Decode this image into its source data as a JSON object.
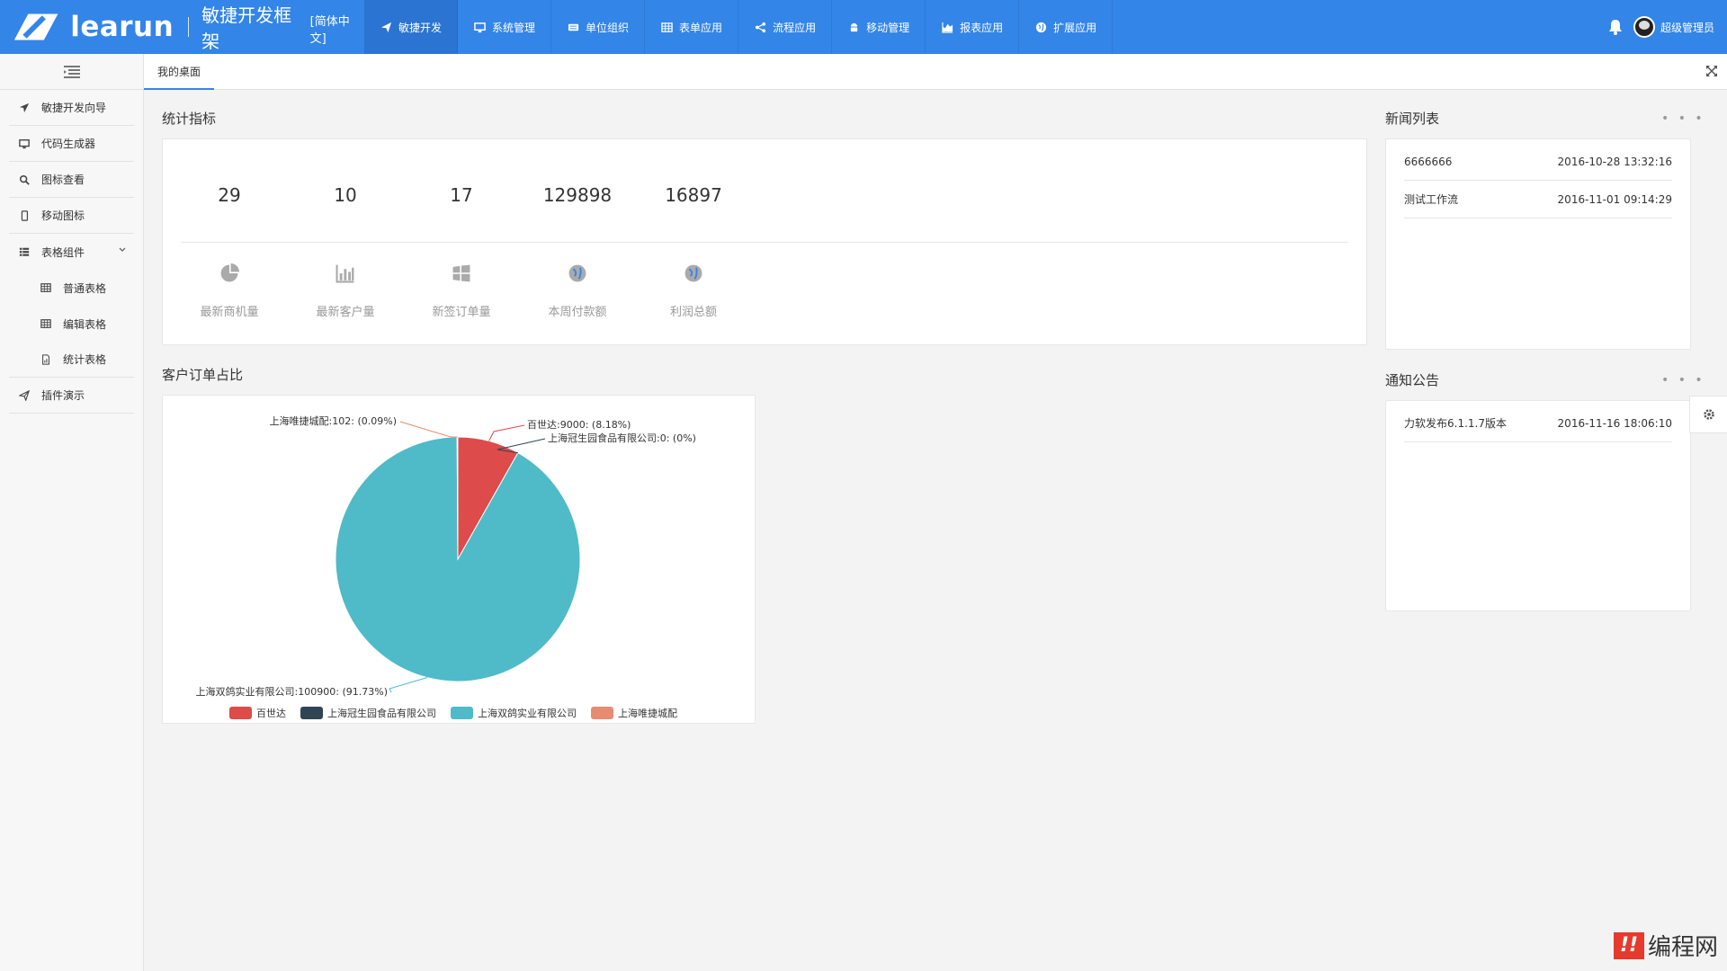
{
  "brand": {
    "name": "learun",
    "subtitle": "敏捷开发框架",
    "lang": "[简体中文]"
  },
  "nav": [
    {
      "label": "敏捷开发",
      "icon": "paper-plane-icon",
      "active": true
    },
    {
      "label": "系统管理",
      "icon": "monitor-icon"
    },
    {
      "label": "单位组织",
      "icon": "keyboard-icon"
    },
    {
      "label": "表单应用",
      "icon": "table-icon"
    },
    {
      "label": "流程应用",
      "icon": "share-icon"
    },
    {
      "label": "移动管理",
      "icon": "android-icon"
    },
    {
      "label": "报表应用",
      "icon": "area-chart-icon"
    },
    {
      "label": "扩展应用",
      "icon": "globe-icon"
    }
  ],
  "user": {
    "name": "超级管理员"
  },
  "sidebar": {
    "items": [
      {
        "label": "敏捷开发向导",
        "icon": "location-arrow-icon"
      },
      {
        "label": "代码生成器",
        "icon": "desktop-icon"
      },
      {
        "label": "图标查看",
        "icon": "search-icon"
      },
      {
        "label": "移动图标",
        "icon": "mobile-icon"
      },
      {
        "label": "表格组件",
        "icon": "list-icon",
        "expanded": true
      },
      {
        "label": "普通表格",
        "icon": "table-icon",
        "sub": true
      },
      {
        "label": "编辑表格",
        "icon": "table-icon",
        "sub": true
      },
      {
        "label": "统计表格",
        "icon": "file-chart-icon",
        "sub": true
      },
      {
        "label": "插件演示",
        "icon": "send-icon"
      }
    ]
  },
  "tabs": [
    {
      "label": "我的桌面",
      "active": true
    }
  ],
  "stats": {
    "title": "统计指标",
    "items": [
      {
        "value": "29",
        "label": "最新商机量",
        "icon": "pie-chart-icon"
      },
      {
        "value": "10",
        "label": "最新客户量",
        "icon": "bar-chart-icon"
      },
      {
        "value": "17",
        "label": "新签订单量",
        "icon": "windows-icon"
      },
      {
        "value": "129898",
        "label": "本周付款额",
        "icon": "globe-icon"
      },
      {
        "value": "16897",
        "label": "利润总额",
        "icon": "globe-icon"
      }
    ]
  },
  "news": {
    "title": "新闻列表",
    "more": "• • •",
    "rows": [
      {
        "title": "6666666",
        "time": "2016-10-28 13:32:16"
      },
      {
        "title": "测试工作流",
        "time": "2016-11-01 09:14:29"
      }
    ]
  },
  "notices": {
    "title": "通知公告",
    "more": "• • •",
    "rows": [
      {
        "title": "力软发布6.1.1.7版本",
        "time": "2016-11-16 18:06:10"
      }
    ]
  },
  "pie_section": {
    "title": "客户订单占比"
  },
  "chart_data": {
    "type": "pie",
    "title": "",
    "slices": [
      {
        "name": "百世达",
        "value": 9000,
        "percent": 8.18,
        "label": "百世达:9000: (8.18%)",
        "color": "#dd4b4b"
      },
      {
        "name": "上海冠生园食品有限公司",
        "value": 0,
        "percent": 0,
        "label": "上海冠生园食品有限公司:0: (0%)",
        "color": "#2f4554"
      },
      {
        "name": "上海双鸽实业有限公司",
        "value": 100900,
        "percent": 91.73,
        "label": "上海双鸽实业有限公司:100900: (91.73%)",
        "color": "#4fbac8"
      },
      {
        "name": "上海唯捷城配",
        "value": 102,
        "percent": 0.09,
        "label": "上海唯捷城配:102: (0.09%)",
        "color": "#e58c72"
      }
    ],
    "legend_position": "bottom"
  },
  "watermark": {
    "box": "!!",
    "text": "编程网"
  },
  "colors": {
    "primary": "#3385e8",
    "active_nav": "#2b74d1"
  }
}
